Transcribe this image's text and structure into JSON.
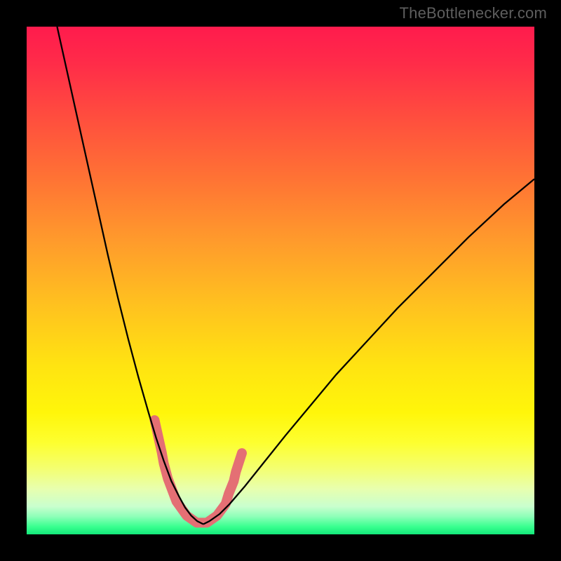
{
  "watermark": "TheBottlenecker.com",
  "chart_data": {
    "type": "line",
    "title": "",
    "xlabel": "",
    "ylabel": "",
    "xlim": [
      0,
      100
    ],
    "ylim": [
      0,
      100
    ],
    "grid": false,
    "legend": false,
    "background_gradient": {
      "stops": [
        {
          "offset": 0.0,
          "color": "#ff1b4d"
        },
        {
          "offset": 0.07,
          "color": "#ff2b49"
        },
        {
          "offset": 0.18,
          "color": "#ff4e3e"
        },
        {
          "offset": 0.3,
          "color": "#ff7334"
        },
        {
          "offset": 0.42,
          "color": "#ff9a2c"
        },
        {
          "offset": 0.55,
          "color": "#ffc21f"
        },
        {
          "offset": 0.67,
          "color": "#ffe411"
        },
        {
          "offset": 0.76,
          "color": "#fff60a"
        },
        {
          "offset": 0.82,
          "color": "#fdff30"
        },
        {
          "offset": 0.87,
          "color": "#f4ff70"
        },
        {
          "offset": 0.91,
          "color": "#e8ffae"
        },
        {
          "offset": 0.945,
          "color": "#c9ffce"
        },
        {
          "offset": 0.965,
          "color": "#8dffb8"
        },
        {
          "offset": 0.985,
          "color": "#38ff8f"
        },
        {
          "offset": 1.0,
          "color": "#13e87a"
        }
      ]
    },
    "series": [
      {
        "name": "left-curve",
        "stroke": "#000000",
        "stroke_width": 2.3,
        "x": [
          6,
          8,
          10,
          12,
          14,
          16,
          18,
          20,
          22,
          24,
          25.5,
          27,
          28.5,
          30,
          31.2,
          32.4,
          33.6,
          34.8
        ],
        "y": [
          100,
          91,
          82,
          73,
          64,
          55,
          46.5,
          38.5,
          31,
          24,
          19,
          14.5,
          10.5,
          7.5,
          5.3,
          3.7,
          2.6,
          2.0
        ]
      },
      {
        "name": "right-curve",
        "stroke": "#000000",
        "stroke_width": 2.3,
        "x": [
          34.8,
          36,
          38,
          40,
          43,
          47,
          51,
          56,
          61,
          67,
          73,
          80,
          87,
          94,
          100
        ],
        "y": [
          2.0,
          2.6,
          4.0,
          6.0,
          9.5,
          14.5,
          19.5,
          25.5,
          31.5,
          38,
          44.5,
          51.5,
          58.5,
          65,
          70
        ]
      },
      {
        "name": "highlight-band",
        "type": "polyline",
        "stroke": "#e46f74",
        "stroke_width": 14,
        "linecap": "round",
        "linejoin": "round",
        "points": [
          [
            25.2,
            22.5
          ],
          [
            26.6,
            16.2
          ],
          [
            27.0,
            14.0
          ],
          [
            27.8,
            11.0
          ],
          [
            29.5,
            6.5
          ],
          [
            31.5,
            3.7
          ],
          [
            33.5,
            2.3
          ],
          [
            35.5,
            2.3
          ],
          [
            37.5,
            3.7
          ],
          [
            39.2,
            6.0
          ],
          [
            39.8,
            8.0
          ],
          [
            40.8,
            10.5
          ],
          [
            41.2,
            12.3
          ],
          [
            42.4,
            16.0
          ]
        ]
      }
    ]
  }
}
